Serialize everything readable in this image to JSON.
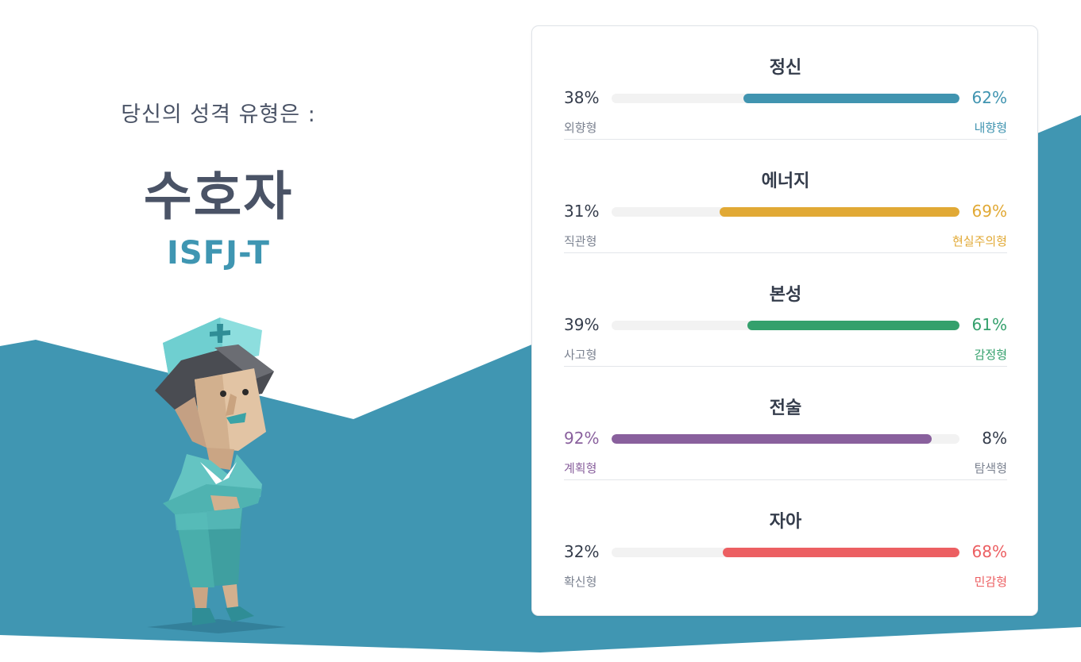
{
  "result": {
    "intro": "당신의 성격 유형은 :",
    "type_name": "수호자",
    "type_code": "ISFJ-T"
  },
  "colors": {
    "background_band": "#4096b2",
    "text_dark": "#4a5366",
    "text_muted": "#7b8290",
    "track": "#f2f2f2"
  },
  "traits": [
    {
      "title": "정신",
      "left_pct": "38%",
      "right_pct": "62%",
      "left_label": "외향형",
      "right_label": "내향형",
      "dominant": "right",
      "fill_fraction": 0.62,
      "color": "#4094b0"
    },
    {
      "title": "에너지",
      "left_pct": "31%",
      "right_pct": "69%",
      "left_label": "직관형",
      "right_label": "현실주의형",
      "dominant": "right",
      "fill_fraction": 0.69,
      "color": "#e1a935"
    },
    {
      "title": "본성",
      "left_pct": "39%",
      "right_pct": "61%",
      "left_label": "사고형",
      "right_label": "감정형",
      "dominant": "right",
      "fill_fraction": 0.61,
      "color": "#34a06c"
    },
    {
      "title": "전술",
      "left_pct": "92%",
      "right_pct": "8%",
      "left_label": "계획형",
      "right_label": "탐색형",
      "dominant": "left",
      "fill_fraction": 0.92,
      "color": "#89609d"
    },
    {
      "title": "자아",
      "left_pct": "32%",
      "right_pct": "68%",
      "left_label": "확신형",
      "right_label": "민감형",
      "dominant": "right",
      "fill_fraction": 0.68,
      "color": "#ec5f62"
    }
  ]
}
